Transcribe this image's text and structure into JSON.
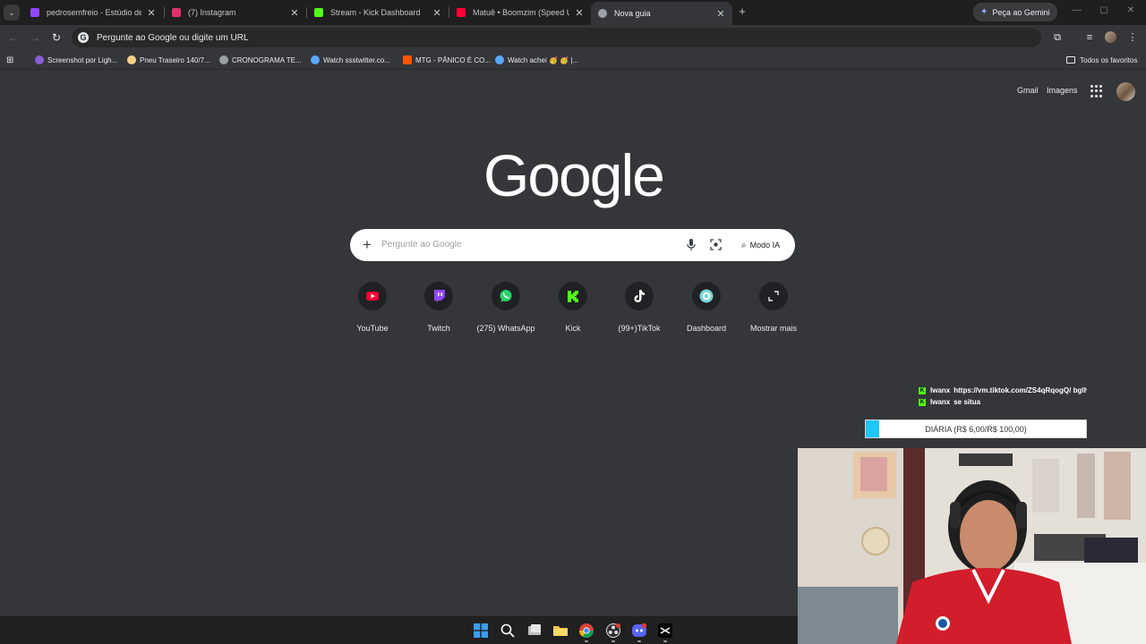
{
  "tabs": [
    {
      "title": "pedrosemfreio - Estúdio de Víde",
      "icon": "twitch-icon",
      "color": "#9146ff"
    },
    {
      "title": "(7) Instagram",
      "icon": "instagram-icon",
      "color": "#e1306c"
    },
    {
      "title": "Stream - Kick Dashboard",
      "icon": "kick-icon",
      "color": "#53fc18"
    },
    {
      "title": "Matuê • Boomzim (Speed UP) (",
      "icon": "youtube-icon",
      "color": "#ff0033"
    },
    {
      "title": "Nova guia",
      "icon": "chrome-icon",
      "color": "#9aa0a6"
    }
  ],
  "gemini_button": "Peça ao Gemini",
  "omnibox": {
    "placeholder": "Pergunte ao Google ou digite um URL"
  },
  "bookmarks": [
    {
      "label": "Screenshot por Ligh...",
      "icon": "lightshot-icon",
      "color": "#8e5bd6"
    },
    {
      "label": "Pneu Traseiro 140/7...",
      "icon": "tire-shop-icon",
      "color": "#f2d28b"
    },
    {
      "label": "CRONOGRAMA TE...",
      "icon": "globe-icon",
      "color": "#9aa0a6"
    },
    {
      "label": "Watch ssstwitter.co...",
      "icon": "watch-icon",
      "color": "#5aa9ff"
    },
    {
      "label": "MTG - PÂNICO É CO...",
      "icon": "soundcloud-icon",
      "color": "#ff5500"
    },
    {
      "label": "Watch achei 🥳 🥳 |...",
      "icon": "watch-icon",
      "color": "#5aa9ff"
    }
  ],
  "all_bookmarks": "Todos os favoritos",
  "header_links": {
    "gmail": "Gmail",
    "images": "Imagens"
  },
  "logo": "Google",
  "search": {
    "placeholder": "Pergunte ao Google",
    "ai_mode": "Modo IA"
  },
  "shortcuts": [
    {
      "label": "YouTube",
      "icon": "youtube-icon",
      "color": "#ff0033"
    },
    {
      "label": "Twitch",
      "icon": "twitch-icon",
      "color": "#9146ff"
    },
    {
      "label": "(275) WhatsApp",
      "icon": "whatsapp-icon",
      "color": "#25d366"
    },
    {
      "label": "Kick",
      "icon": "kick-icon",
      "color": "#53fc18"
    },
    {
      "label": "(99+)TikTok",
      "icon": "tiktok-icon",
      "color": "#ffffff"
    },
    {
      "label": "Dashboard",
      "icon": "dashboard-icon",
      "color": "#7ad3d0"
    },
    {
      "label": "Mostrar mais",
      "icon": "expand-icon",
      "color": "#e8eaed"
    }
  ],
  "chat": [
    {
      "user": "Iwanx",
      "message": "https://vm.tiktok.com/ZS4qRqogQ/ bglh t"
    },
    {
      "user": "Iwanx",
      "message": "se situa"
    }
  ],
  "goal": {
    "label": "DIÁRIA (R$ 6,00/R$ 100,00)",
    "progress": 0.06,
    "fill_color": "#1fc7f7"
  },
  "taskbar": [
    {
      "name": "windows-start-icon"
    },
    {
      "name": "search-icon"
    },
    {
      "name": "task-view-icon"
    },
    {
      "name": "file-explorer-icon"
    },
    {
      "name": "chrome-icon"
    },
    {
      "name": "obs-icon"
    },
    {
      "name": "discord-icon"
    },
    {
      "name": "capcut-icon"
    }
  ]
}
